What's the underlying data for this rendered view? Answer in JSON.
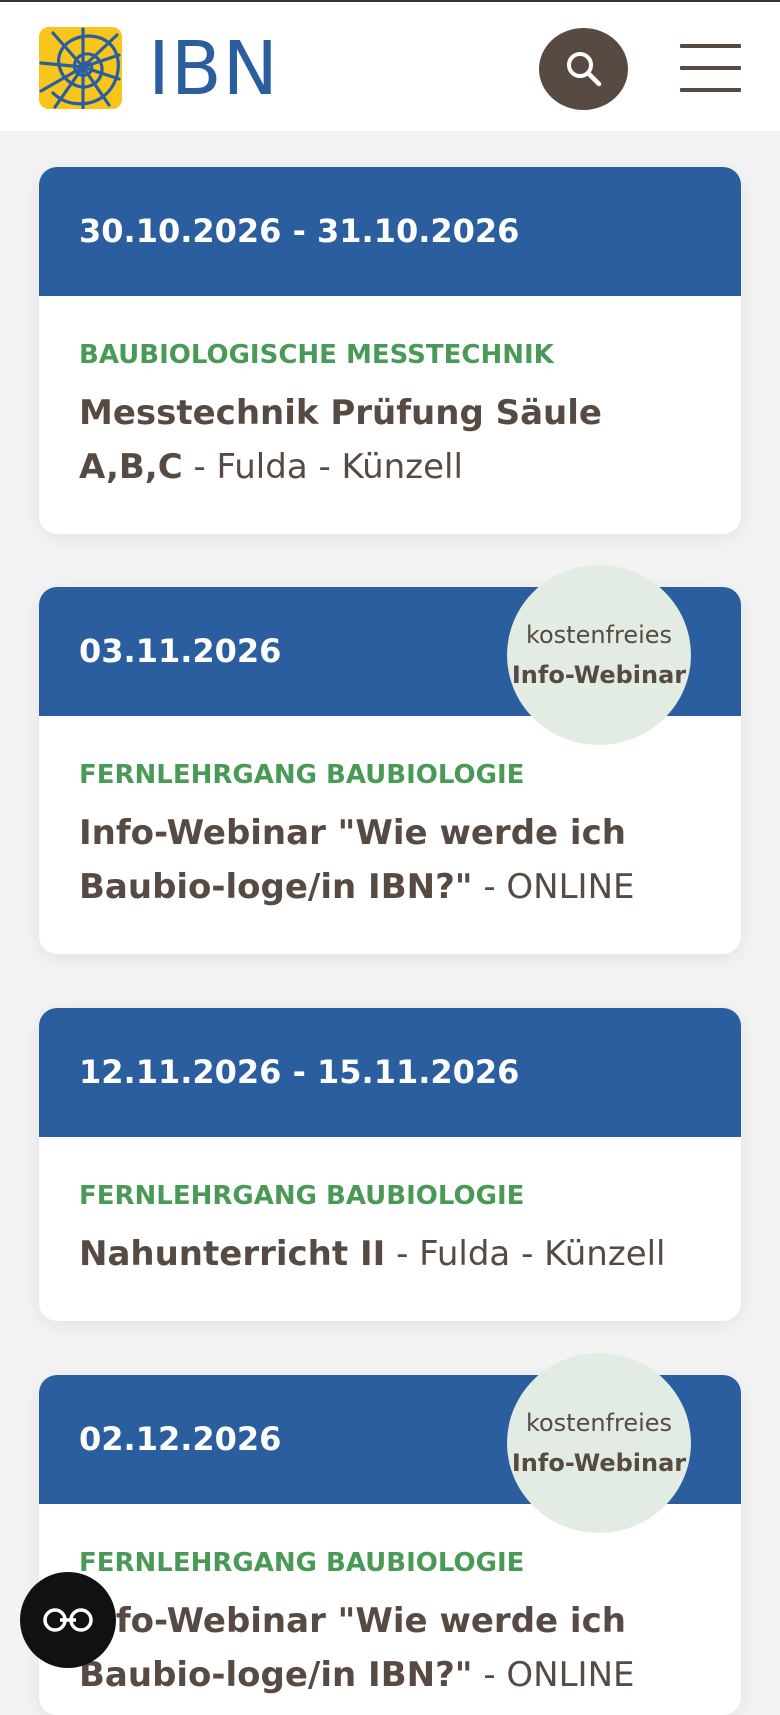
{
  "header": {
    "logo_text": "IBN",
    "brand_color": "#2a5e9e",
    "logo_bg": "#f7c51c",
    "search_icon": "search-icon",
    "menu_icon": "hamburger-menu-icon"
  },
  "events": [
    {
      "date": "30.10.2026 - 31.10.2026",
      "category": "BAUBIOLOGISCHE MESSTECHNIK",
      "title": "Messtechnik Prüfung Säule A,B,C",
      "location": " - Fulda - Künzell"
    },
    {
      "date": "03.11.2026",
      "category": "FERNLEHRGANG BAUBIOLOGIE",
      "title": "Info-Webinar \"Wie werde ich Baubio-loge/in IBN?\"",
      "location": " - ONLINE",
      "badge_line1": "kostenfreies",
      "badge_line2": "Info-Webinar"
    },
    {
      "date": "12.11.2026 - 15.11.2026",
      "category": "FERNLEHRGANG BAUBIOLOGIE",
      "title": "Nahunterricht II",
      "location": " - Fulda - Künzell"
    },
    {
      "date": "02.12.2026",
      "category": "FERNLEHRGANG BAUBIOLOGIE",
      "title": "Info-Webinar \"Wie werde ich Baubio-loge/in IBN?\"",
      "location": " - ONLINE",
      "badge_line1": "kostenfreies",
      "badge_line2": "Info-Webinar"
    }
  ],
  "chat_button_icon": "chat-glasses-icon",
  "colors": {
    "header_blue": "#2a5e9e",
    "category_green": "#4a9a57",
    "text_brown": "#574a42",
    "badge_bg": "#e2ece2"
  }
}
